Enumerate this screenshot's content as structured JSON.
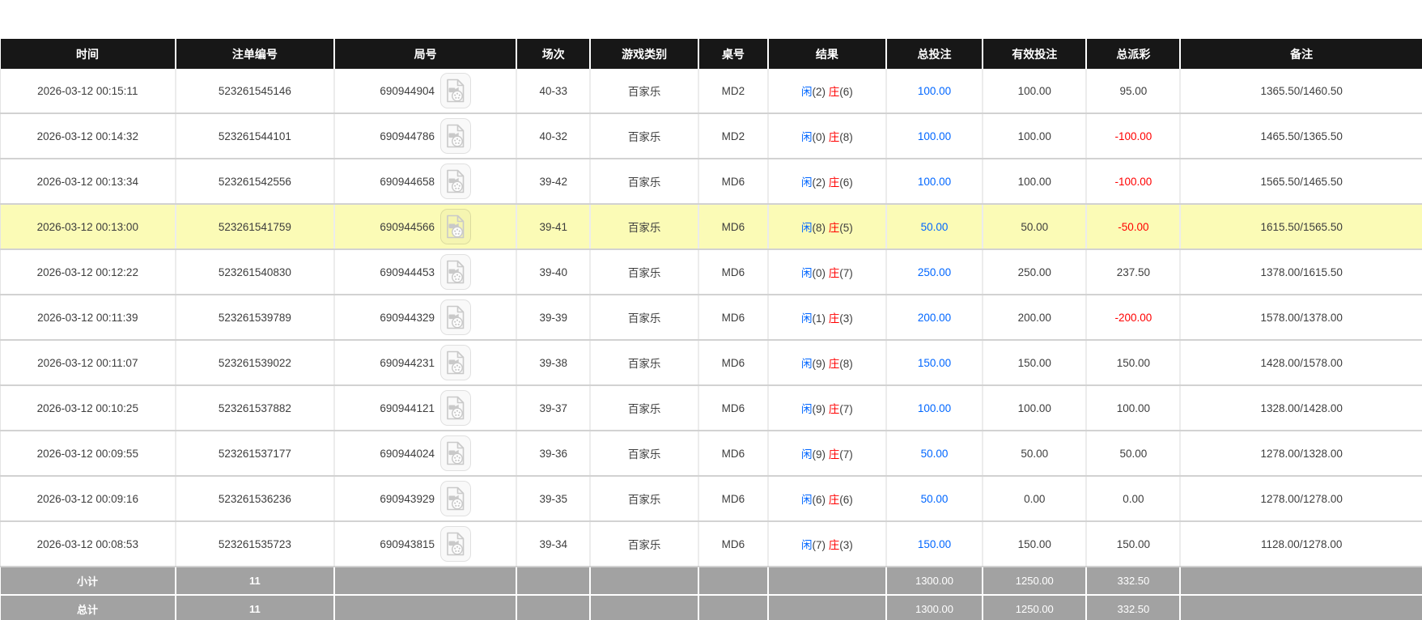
{
  "colors": {
    "header_bg": "#171717",
    "header_text": "#ffffff",
    "row_highlight": "#fbfbb6",
    "summary_bg": "#a2a2a2",
    "player_blue": "#0066ff",
    "banker_red": "#ff0000",
    "bet_blue": "#0066ff",
    "negative_red": "#ff0000",
    "text": "#3d3d3d"
  },
  "table": {
    "columns": [
      {
        "key": "time",
        "label": "时间"
      },
      {
        "key": "bet_id",
        "label": "注单编号"
      },
      {
        "key": "round_id",
        "label": "局号"
      },
      {
        "key": "session",
        "label": "场次"
      },
      {
        "key": "game_type",
        "label": "游戏类别"
      },
      {
        "key": "table_id",
        "label": "桌号"
      },
      {
        "key": "result",
        "label": "结果"
      },
      {
        "key": "total_bet",
        "label": "总投注"
      },
      {
        "key": "valid_bet",
        "label": "有效投注"
      },
      {
        "key": "payout",
        "label": "总派彩"
      },
      {
        "key": "remark",
        "label": "备注"
      }
    ],
    "video_icon": "video-file-icon",
    "rows": [
      {
        "time": "2026-03-12 00:15:11",
        "bet_id": "523261545146",
        "round_id": "690944904",
        "session": "40-33",
        "game_type": "百家乐",
        "table_id": "MD2",
        "result": {
          "player": "闲",
          "player_points": "(2)",
          "banker": "庄",
          "banker_points": "(6)"
        },
        "total_bet": "100.00",
        "valid_bet": "100.00",
        "payout": "95.00",
        "payout_negative": false,
        "remark": "1365.50/1460.50",
        "highlighted": false
      },
      {
        "time": "2026-03-12 00:14:32",
        "bet_id": "523261544101",
        "round_id": "690944786",
        "session": "40-32",
        "game_type": "百家乐",
        "table_id": "MD2",
        "result": {
          "player": "闲",
          "player_points": "(0)",
          "banker": "庄",
          "banker_points": "(8)"
        },
        "total_bet": "100.00",
        "valid_bet": "100.00",
        "payout": "-100.00",
        "payout_negative": true,
        "remark": "1465.50/1365.50",
        "highlighted": false
      },
      {
        "time": "2026-03-12 00:13:34",
        "bet_id": "523261542556",
        "round_id": "690944658",
        "session": "39-42",
        "game_type": "百家乐",
        "table_id": "MD6",
        "result": {
          "player": "闲",
          "player_points": "(2)",
          "banker": "庄",
          "banker_points": "(6)"
        },
        "total_bet": "100.00",
        "valid_bet": "100.00",
        "payout": "-100.00",
        "payout_negative": true,
        "remark": "1565.50/1465.50",
        "highlighted": false
      },
      {
        "time": "2026-03-12 00:13:00",
        "bet_id": "523261541759",
        "round_id": "690944566",
        "session": "39-41",
        "game_type": "百家乐",
        "table_id": "MD6",
        "result": {
          "player": "闲",
          "player_points": "(8)",
          "banker": "庄",
          "banker_points": "(5)"
        },
        "total_bet": "50.00",
        "valid_bet": "50.00",
        "payout": "-50.00",
        "payout_negative": true,
        "remark": "1615.50/1565.50",
        "highlighted": true
      },
      {
        "time": "2026-03-12 00:12:22",
        "bet_id": "523261540830",
        "round_id": "690944453",
        "session": "39-40",
        "game_type": "百家乐",
        "table_id": "MD6",
        "result": {
          "player": "闲",
          "player_points": "(0)",
          "banker": "庄",
          "banker_points": "(7)"
        },
        "total_bet": "250.00",
        "valid_bet": "250.00",
        "payout": "237.50",
        "payout_negative": false,
        "remark": "1378.00/1615.50",
        "highlighted": false
      },
      {
        "time": "2026-03-12 00:11:39",
        "bet_id": "523261539789",
        "round_id": "690944329",
        "session": "39-39",
        "game_type": "百家乐",
        "table_id": "MD6",
        "result": {
          "player": "闲",
          "player_points": "(1)",
          "banker": "庄",
          "banker_points": "(3)"
        },
        "total_bet": "200.00",
        "valid_bet": "200.00",
        "payout": "-200.00",
        "payout_negative": true,
        "remark": "1578.00/1378.00",
        "highlighted": false
      },
      {
        "time": "2026-03-12 00:11:07",
        "bet_id": "523261539022",
        "round_id": "690944231",
        "session": "39-38",
        "game_type": "百家乐",
        "table_id": "MD6",
        "result": {
          "player": "闲",
          "player_points": "(9)",
          "banker": "庄",
          "banker_points": "(8)"
        },
        "total_bet": "150.00",
        "valid_bet": "150.00",
        "payout": "150.00",
        "payout_negative": false,
        "remark": "1428.00/1578.00",
        "highlighted": false
      },
      {
        "time": "2026-03-12 00:10:25",
        "bet_id": "523261537882",
        "round_id": "690944121",
        "session": "39-37",
        "game_type": "百家乐",
        "table_id": "MD6",
        "result": {
          "player": "闲",
          "player_points": "(9)",
          "banker": "庄",
          "banker_points": "(7)"
        },
        "total_bet": "100.00",
        "valid_bet": "100.00",
        "payout": "100.00",
        "payout_negative": false,
        "remark": "1328.00/1428.00",
        "highlighted": false
      },
      {
        "time": "2026-03-12 00:09:55",
        "bet_id": "523261537177",
        "round_id": "690944024",
        "session": "39-36",
        "game_type": "百家乐",
        "table_id": "MD6",
        "result": {
          "player": "闲",
          "player_points": "(9)",
          "banker": "庄",
          "banker_points": "(7)"
        },
        "total_bet": "50.00",
        "valid_bet": "50.00",
        "payout": "50.00",
        "payout_negative": false,
        "remark": "1278.00/1328.00",
        "highlighted": false
      },
      {
        "time": "2026-03-12 00:09:16",
        "bet_id": "523261536236",
        "round_id": "690943929",
        "session": "39-35",
        "game_type": "百家乐",
        "table_id": "MD6",
        "result": {
          "player": "闲",
          "player_points": "(6)",
          "banker": "庄",
          "banker_points": "(6)"
        },
        "total_bet": "50.00",
        "valid_bet": "0.00",
        "payout": "0.00",
        "payout_negative": false,
        "remark": "1278.00/1278.00",
        "highlighted": false
      },
      {
        "time": "2026-03-12 00:08:53",
        "bet_id": "523261535723",
        "round_id": "690943815",
        "session": "39-34",
        "game_type": "百家乐",
        "table_id": "MD6",
        "result": {
          "player": "闲",
          "player_points": "(7)",
          "banker": "庄",
          "banker_points": "(3)"
        },
        "total_bet": "150.00",
        "valid_bet": "150.00",
        "payout": "150.00",
        "payout_negative": false,
        "remark": "1128.00/1278.00",
        "highlighted": false
      }
    ],
    "subtotal": {
      "label": "小计",
      "count": "11",
      "total_bet": "1300.00",
      "valid_bet": "1250.00",
      "payout": "332.50"
    },
    "grand_total": {
      "label": "总计",
      "count": "11",
      "total_bet": "1300.00",
      "valid_bet": "1250.00",
      "payout": "332.50"
    }
  }
}
